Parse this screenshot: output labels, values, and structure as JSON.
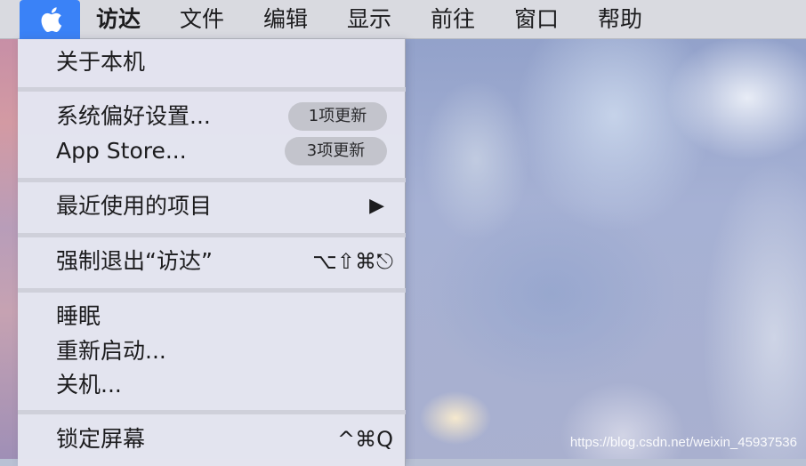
{
  "menubar": {
    "apple_menu_icon": "apple-logo-icon",
    "items": [
      "访达",
      "文件",
      "编辑",
      "显示",
      "前往",
      "窗口",
      "帮助"
    ],
    "accent_color": "#3a82f7"
  },
  "apple_menu": {
    "about": "关于本机",
    "system_prefs": {
      "label": "系统偏好设置...",
      "badge": "1项更新"
    },
    "app_store": {
      "label": "App Store...",
      "badge": "3项更新"
    },
    "recent_items": {
      "label": "最近使用的项目",
      "submenu_icon": "triangle-right-icon"
    },
    "force_quit": {
      "label": "强制退出“访达”",
      "shortcut": "⌥⇧⌘⎋"
    },
    "sleep": "睡眠",
    "restart": "重新启动...",
    "shutdown": "关机...",
    "lock_screen": {
      "label": "锁定屏幕",
      "shortcut": "^⌘Q"
    }
  },
  "watermark": "https://blog.csdn.net/weixin_45937536"
}
